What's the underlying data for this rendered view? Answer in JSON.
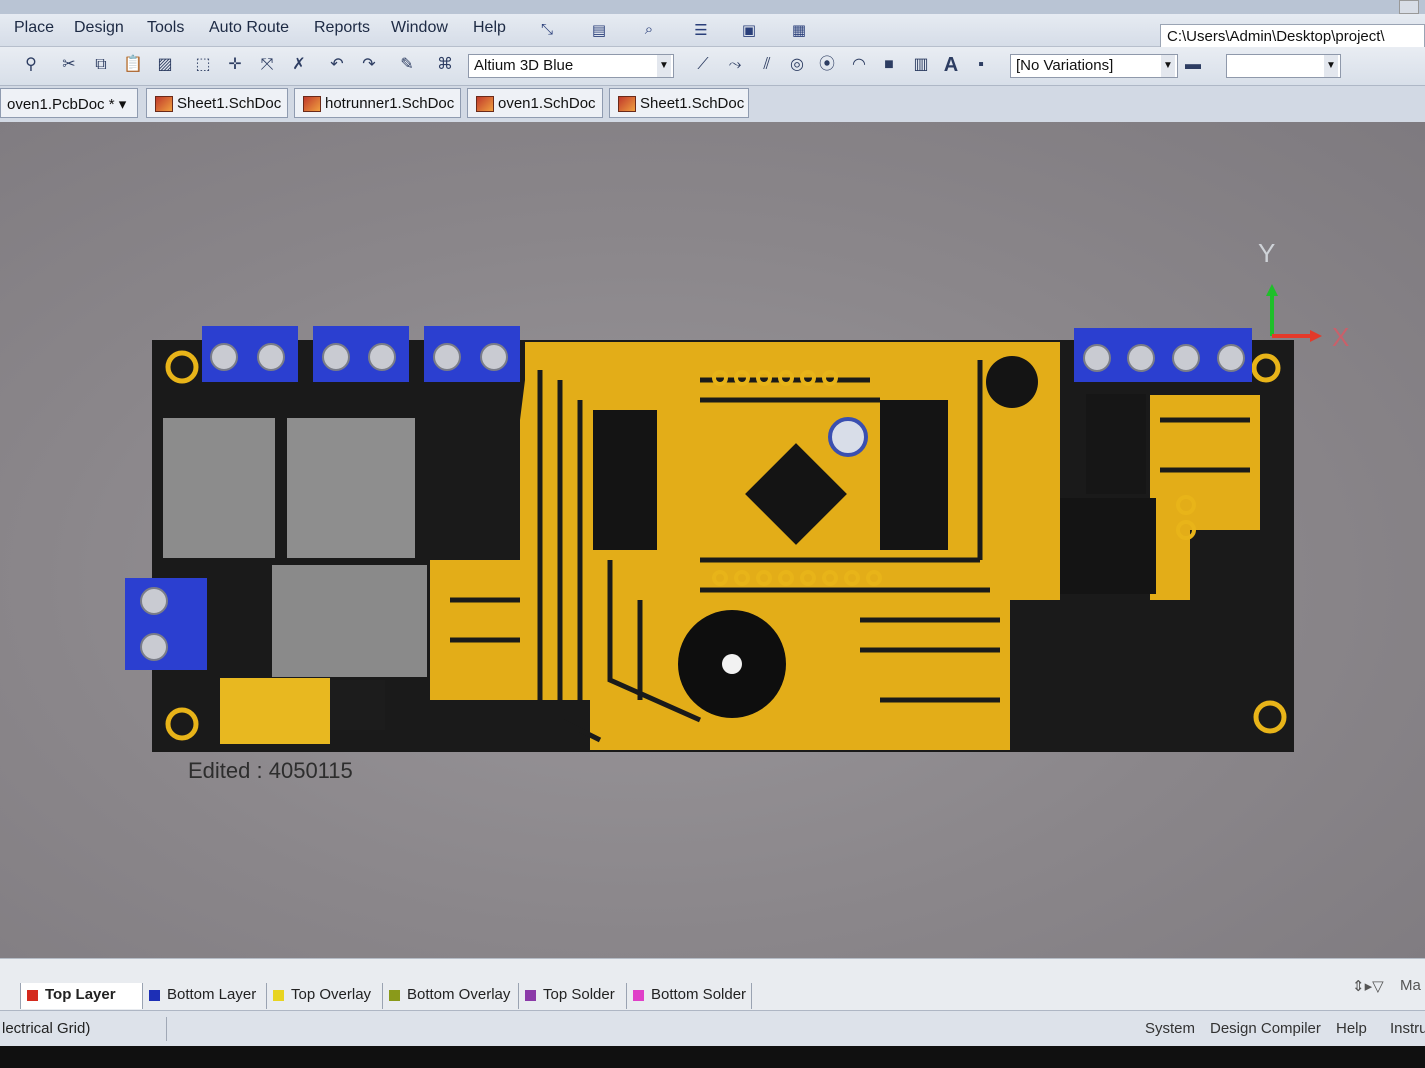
{
  "menubar": {
    "items": [
      "Place",
      "Design",
      "Tools",
      "Auto Route",
      "Reports",
      "Window",
      "Help"
    ]
  },
  "path": "C:\\Users\\Admin\\Desktop\\project\\",
  "toolbar": {
    "view_mode": "Altium 3D Blue",
    "variations": "[No Variations]"
  },
  "tabs": [
    "oven1.PcbDoc *",
    "Sheet1.SchDoc",
    "hotrunner1.SchDoc",
    "oven1.SchDoc",
    "Sheet1.SchDoc"
  ],
  "canvas": {
    "edited_label": "Edited :",
    "edited_value": "4050115",
    "axis_y": "Y",
    "axis_x": "X"
  },
  "layers": [
    {
      "label": "Top Layer",
      "color": "#d42a1e",
      "active": true
    },
    {
      "label": "Bottom Layer",
      "color": "#1d2fb6",
      "active": false
    },
    {
      "label": "Top Overlay",
      "color": "#e8d420",
      "active": false
    },
    {
      "label": "Bottom Overlay",
      "color": "#8a9a1a",
      "active": false
    },
    {
      "label": "Top Solder",
      "color": "#8b3aa8",
      "active": false
    },
    {
      "label": "Bottom Solder",
      "color": "#e040c8",
      "active": false
    }
  ],
  "layer_right": "Ma",
  "status": {
    "grid": "lectrical Grid)",
    "system": "System",
    "design_compiler": "Design Compiler",
    "help": "Help",
    "instruments": "Instru"
  },
  "colors": {
    "board": "#1a1a1a",
    "copper": "#e8b419",
    "terminal": "#2b3fd0"
  }
}
